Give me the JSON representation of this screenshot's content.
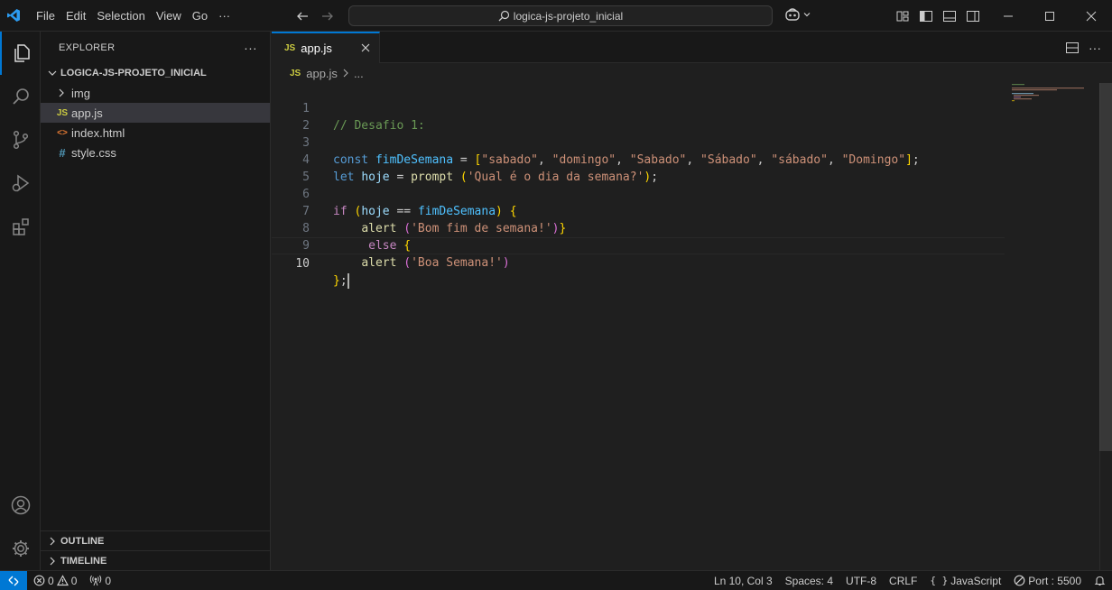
{
  "titlebar": {
    "menu": [
      {
        "label": "File"
      },
      {
        "label": "Edit"
      },
      {
        "label": "Selection"
      },
      {
        "label": "View"
      },
      {
        "label": "Go"
      },
      {
        "label": "···"
      }
    ],
    "search_text": "logica-js-projeto_inicial"
  },
  "sidebar": {
    "header": "EXPLORER",
    "more": "···",
    "folder": "LOGICA-JS-PROJETO_INICIAL",
    "items": [
      {
        "label": "img",
        "icon": "chevron-right-icon"
      },
      {
        "label": "app.js",
        "icon": "JS"
      },
      {
        "label": "index.html",
        "icon": "<>"
      },
      {
        "label": "style.css",
        "icon": "#"
      }
    ],
    "outline": "OUTLINE",
    "timeline": "TIMELINE"
  },
  "editor": {
    "tab_label": "app.js",
    "tab_badge": "JS",
    "breadcrumb_file": "app.js",
    "breadcrumb_more": "...",
    "line_numbers": [
      "1",
      "2",
      "3",
      "4",
      "5",
      "6",
      "7",
      "8",
      "9",
      "10"
    ]
  },
  "code": {
    "l1": "// Desafio 1:",
    "l3_kw": "const",
    "l3_name": "fimDeSemana",
    "l3_eq": " = ",
    "l3_s1": "\"sabado\"",
    "l3_s2": "\"domingo\"",
    "l3_s3": "\"Sabado\"",
    "l3_s4": "\"Sábado\"",
    "l3_s5": "\"sábado\"",
    "l3_s6": "\"Domingo\"",
    "l4_kw": "let",
    "l4_name": "hoje",
    "l4_eq": " = ",
    "l4_fn": "prompt",
    "l4_str": "'Qual é o dia da semana?'",
    "l6_kw": "if",
    "l6_a": "hoje",
    "l6_op": " == ",
    "l6_b": "fimDeSemana",
    "l7_fn": "alert",
    "l7_str": "'Bom fim de semana!'",
    "l8_kw": "else",
    "l9_fn": "alert",
    "l9_str": "'Boa Semana!'"
  },
  "statusbar": {
    "errors": "0",
    "warnings": "0",
    "ports": "0",
    "position": "Ln 10, Col 3",
    "spaces": "Spaces: 4",
    "encoding": "UTF-8",
    "eol": "CRLF",
    "language": "JavaScript",
    "port": "Port : 5500"
  },
  "colors": {
    "accent": "#0078d4",
    "js_badge": "#cbcb41",
    "html_icon": "#e37933",
    "css_icon": "#519aba"
  }
}
